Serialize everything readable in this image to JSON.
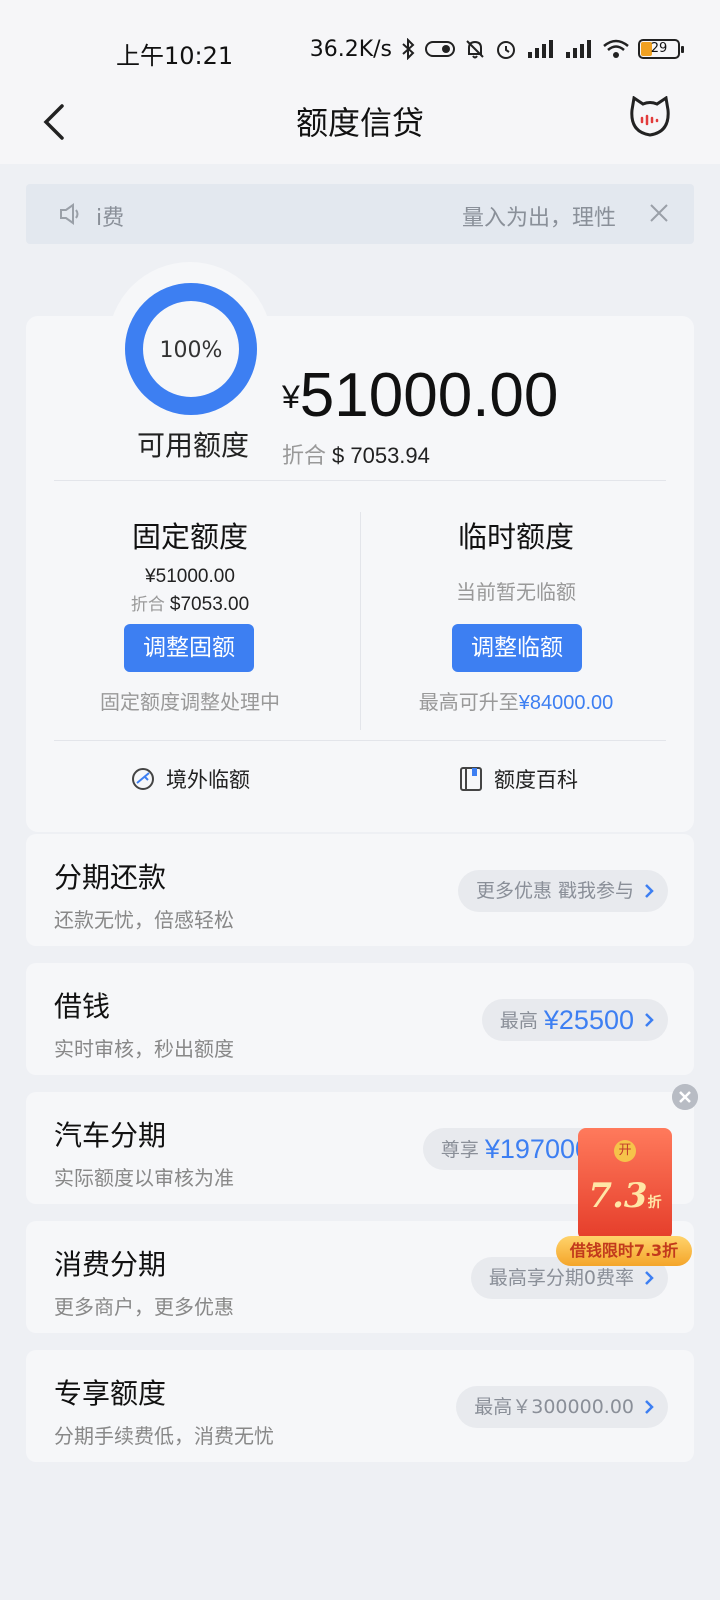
{
  "status_bar": {
    "time": "上午10:21",
    "speed": "36.2K/s",
    "battery": "29"
  },
  "nav": {
    "title": "额度信贷"
  },
  "notice": {
    "left_text": "i费",
    "right_text": "量入为出，理性"
  },
  "credit": {
    "ring_percent": "100%",
    "ring_progress": 1.0,
    "available_label": "可用额度",
    "currency": "¥",
    "amount": "51000.00",
    "converted_prefix": "折合",
    "converted_value": "$ 7053.94",
    "fixed": {
      "title": "固定额度",
      "amount": "¥51000.00",
      "converted_prefix": "折合",
      "converted_value": "$7053.00",
      "button": "调整固额",
      "note": "固定额度调整处理中"
    },
    "temp": {
      "title": "临时额度",
      "status": "当前暂无临额",
      "button": "调整临额",
      "note_prefix": "最高可升至",
      "note_value": "¥84000.00"
    },
    "links": {
      "overseas": "境外临额",
      "wiki": "额度百科"
    }
  },
  "services": [
    {
      "title": "分期还款",
      "subtitle": "还款无忧，倍感轻松",
      "pill_text": "更多优惠 戳我参与",
      "pill_value": ""
    },
    {
      "title": "借钱",
      "subtitle": "实时审核，秒出额度",
      "pill_text": "最高",
      "pill_value": "¥25500"
    },
    {
      "title": "汽车分期",
      "subtitle": "实际额度以审核为准",
      "pill_text": "尊享",
      "pill_value": "¥197000"
    },
    {
      "title": "消费分期",
      "subtitle": "更多商户，更多优惠",
      "pill_text": "最高享分期0费率",
      "pill_value": ""
    },
    {
      "title": "专享额度",
      "subtitle": "分期手续费低，消费无忧",
      "pill_text": "最高￥300000.00",
      "pill_value": ""
    }
  ],
  "promo": {
    "open_char": "开",
    "discount": "7.3",
    "discount_unit": "折",
    "tag": "借钱限时7.3折"
  },
  "colors": {
    "accent": "#3d7ff2",
    "background": "#eef0f4",
    "card": "#f6f7f9",
    "promo_red": "#e53d2a"
  }
}
